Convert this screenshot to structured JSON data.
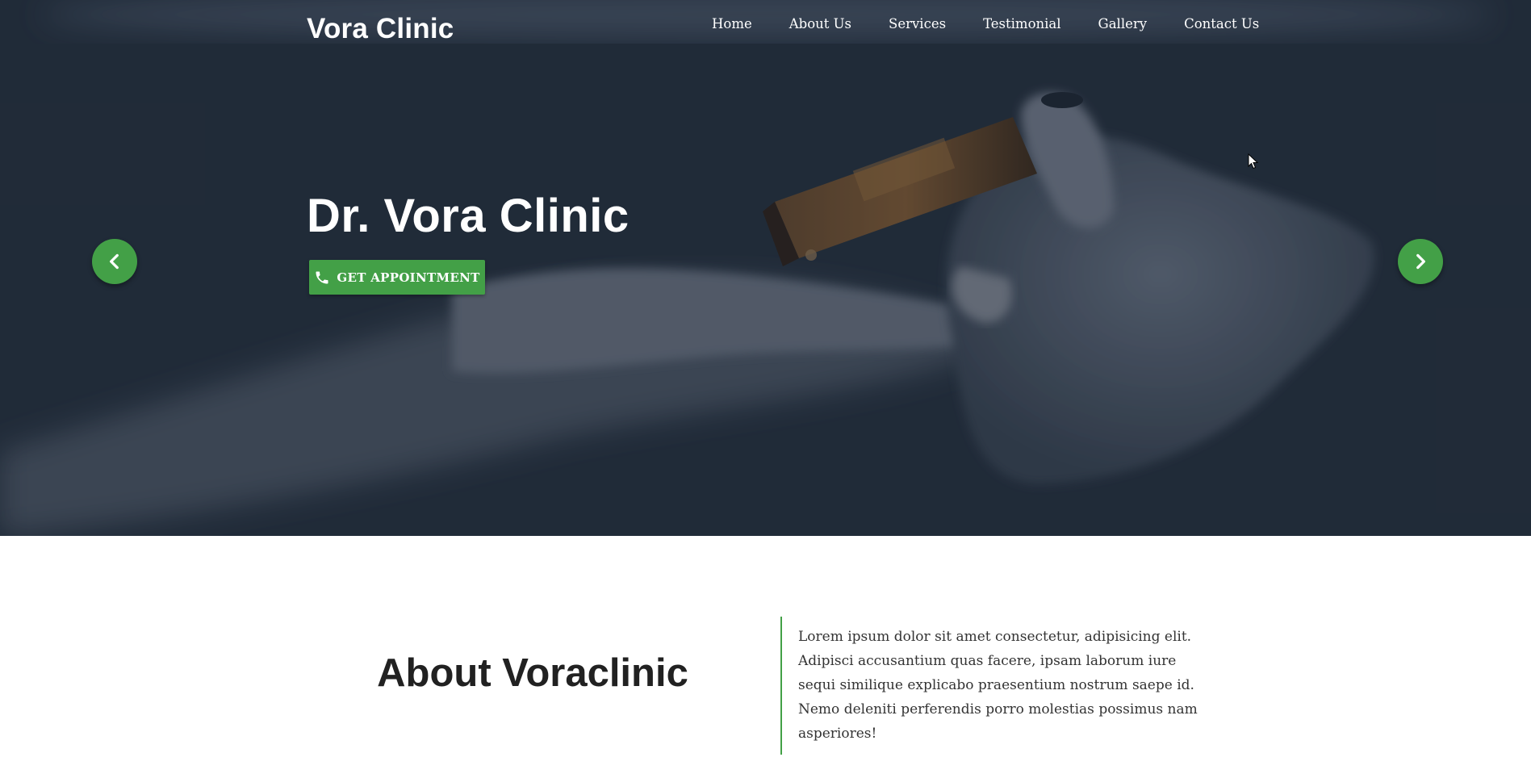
{
  "brand": "Vora Clinic",
  "nav": {
    "items": [
      {
        "label": "Home"
      },
      {
        "label": "About Us"
      },
      {
        "label": "Services"
      },
      {
        "label": "Testimonial"
      },
      {
        "label": "Gallery"
      },
      {
        "label": "Contact Us"
      }
    ]
  },
  "hero": {
    "title": "Dr. Vora Clinic",
    "cta_label": "GET APPOINTMENT",
    "cta_icon": "phone-icon",
    "prev_icon": "chevron-left-icon",
    "next_icon": "chevron-right-icon"
  },
  "about": {
    "title": "About Voraclinic",
    "text": "Lorem ipsum dolor sit amet consectetur, adipisicing elit. Adipisci accusantium quas facere, ipsam laborum iure sequi similique explicabo praesentium nostrum saepe id. Nemo deleniti perferendis porro molestias possimus nam asperiores!"
  },
  "colors": {
    "accent": "#43a047",
    "hero_overlay": "#1f2733",
    "heading_text": "#212121",
    "body_text": "#333333"
  }
}
